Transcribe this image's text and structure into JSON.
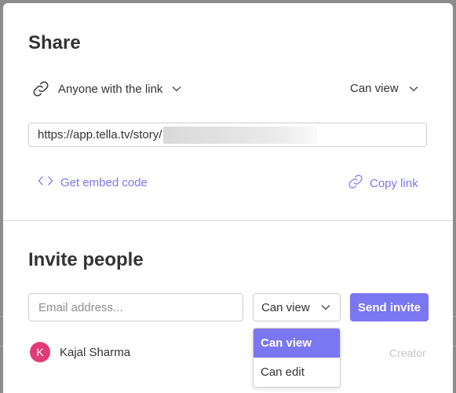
{
  "share": {
    "title": "Share",
    "link_access_label": "Anyone with the link",
    "link_permission": "Can view",
    "url": "https://app.tella.tv/story/",
    "embed_label": "Get embed code",
    "copy_label": "Copy link"
  },
  "invite": {
    "title": "Invite people",
    "email_placeholder": "Email address...",
    "permission_selected": "Can view",
    "send_label": "Send invite",
    "permission_options": [
      "Can view",
      "Can edit"
    ],
    "members": [
      {
        "initial": "K",
        "name": "Kajal Sharma",
        "role": "Creator"
      }
    ]
  },
  "colors": {
    "accent": "#7b76f2",
    "avatar": "#e23a74"
  }
}
